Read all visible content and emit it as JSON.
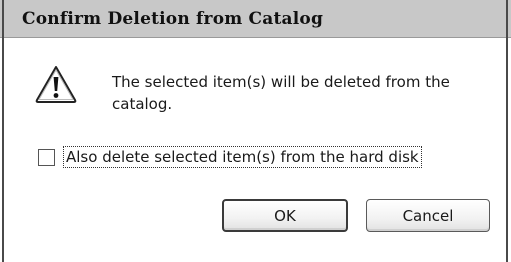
{
  "dialog": {
    "title": "Confirm Deletion from Catalog",
    "message": "The selected item(s) will be deleted from the catalog.",
    "icon": "warning-icon",
    "checkbox": {
      "label": "Also delete selected item(s) from the hard disk",
      "checked": false
    },
    "buttons": {
      "ok": "OK",
      "cancel": "Cancel"
    }
  }
}
